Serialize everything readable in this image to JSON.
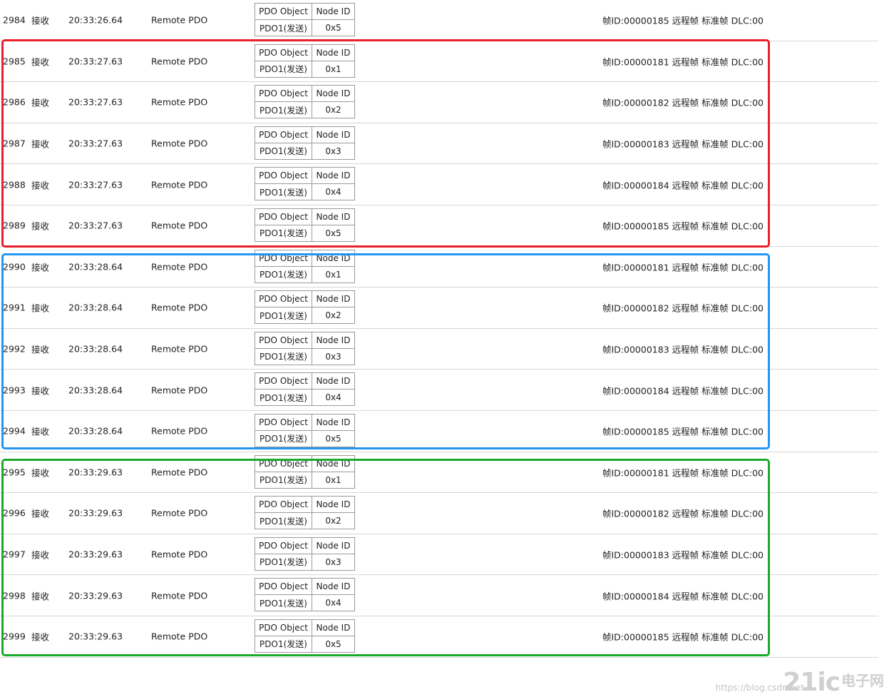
{
  "table": {
    "sub_header": {
      "object_label": "PDO Object",
      "node_label": "Node ID"
    },
    "rows": [
      {
        "index": "2984",
        "direction": "接收",
        "time": "20:33:26.64",
        "type": "Remote PDO",
        "pdo": "PDO1(发送)",
        "node": "0x5",
        "frame": "帧ID:00000185 远程帧 标准帧 DLC:00"
      },
      {
        "index": "2985",
        "direction": "接收",
        "time": "20:33:27.63",
        "type": "Remote PDO",
        "pdo": "PDO1(发送)",
        "node": "0x1",
        "frame": "帧ID:00000181 远程帧 标准帧 DLC:00"
      },
      {
        "index": "2986",
        "direction": "接收",
        "time": "20:33:27.63",
        "type": "Remote PDO",
        "pdo": "PDO1(发送)",
        "node": "0x2",
        "frame": "帧ID:00000182 远程帧 标准帧 DLC:00"
      },
      {
        "index": "2987",
        "direction": "接收",
        "time": "20:33:27.63",
        "type": "Remote PDO",
        "pdo": "PDO1(发送)",
        "node": "0x3",
        "frame": "帧ID:00000183 远程帧 标准帧 DLC:00"
      },
      {
        "index": "2988",
        "direction": "接收",
        "time": "20:33:27.63",
        "type": "Remote PDO",
        "pdo": "PDO1(发送)",
        "node": "0x4",
        "frame": "帧ID:00000184 远程帧 标准帧 DLC:00"
      },
      {
        "index": "2989",
        "direction": "接收",
        "time": "20:33:27.63",
        "type": "Remote PDO",
        "pdo": "PDO1(发送)",
        "node": "0x5",
        "frame": "帧ID:00000185 远程帧 标准帧 DLC:00"
      },
      {
        "index": "2990",
        "direction": "接收",
        "time": "20:33:28.64",
        "type": "Remote PDO",
        "pdo": "PDO1(发送)",
        "node": "0x1",
        "frame": "帧ID:00000181 远程帧 标准帧 DLC:00"
      },
      {
        "index": "2991",
        "direction": "接收",
        "time": "20:33:28.64",
        "type": "Remote PDO",
        "pdo": "PDO1(发送)",
        "node": "0x2",
        "frame": "帧ID:00000182 远程帧 标准帧 DLC:00"
      },
      {
        "index": "2992",
        "direction": "接收",
        "time": "20:33:28.64",
        "type": "Remote PDO",
        "pdo": "PDO1(发送)",
        "node": "0x3",
        "frame": "帧ID:00000183 远程帧 标准帧 DLC:00"
      },
      {
        "index": "2993",
        "direction": "接收",
        "time": "20:33:28.64",
        "type": "Remote PDO",
        "pdo": "PDO1(发送)",
        "node": "0x4",
        "frame": "帧ID:00000184 远程帧 标准帧 DLC:00"
      },
      {
        "index": "2994",
        "direction": "接收",
        "time": "20:33:28.64",
        "type": "Remote PDO",
        "pdo": "PDO1(发送)",
        "node": "0x5",
        "frame": "帧ID:00000185 远程帧 标准帧 DLC:00"
      },
      {
        "index": "2995",
        "direction": "接收",
        "time": "20:33:29.63",
        "type": "Remote PDO",
        "pdo": "PDO1(发送)",
        "node": "0x1",
        "frame": "帧ID:00000181 远程帧 标准帧 DLC:00"
      },
      {
        "index": "2996",
        "direction": "接收",
        "time": "20:33:29.63",
        "type": "Remote PDO",
        "pdo": "PDO1(发送)",
        "node": "0x2",
        "frame": "帧ID:00000182 远程帧 标准帧 DLC:00"
      },
      {
        "index": "2997",
        "direction": "接收",
        "time": "20:33:29.63",
        "type": "Remote PDO",
        "pdo": "PDO1(发送)",
        "node": "0x3",
        "frame": "帧ID:00000183 远程帧 标准帧 DLC:00"
      },
      {
        "index": "2998",
        "direction": "接收",
        "time": "20:33:29.63",
        "type": "Remote PDO",
        "pdo": "PDO1(发送)",
        "node": "0x4",
        "frame": "帧ID:00000184 远程帧 标准帧 DLC:00"
      },
      {
        "index": "2999",
        "direction": "接收",
        "time": "20:33:29.63",
        "type": "Remote PDO",
        "pdo": "PDO1(发送)",
        "node": "0x5",
        "frame": "帧ID:00000185 远程帧 标准帧 DLC:00"
      }
    ]
  },
  "highlight_colors": {
    "red": "#e8202a",
    "blue": "#2196f3",
    "green": "#1aaa2a"
  },
  "watermark": {
    "url": "https://blog.csdn.net",
    "logo": "21ic",
    "cn": "电子网"
  }
}
